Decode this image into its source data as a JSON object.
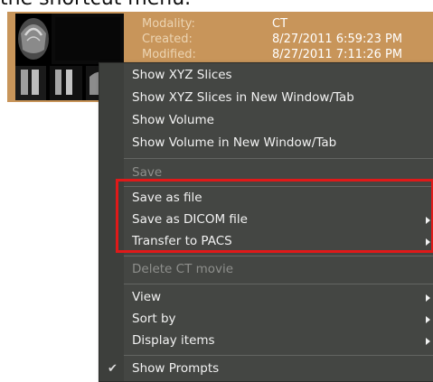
{
  "caption": "the shortcut menu.",
  "study": {
    "fields": [
      {
        "key": "Modality:",
        "value": "CT"
      },
      {
        "key": "Created:",
        "value": "8/27/2011 6:59:23 PM"
      },
      {
        "key": "Modified:",
        "value": "8/27/2011 7:11:26 PM"
      }
    ]
  },
  "menu": {
    "items": [
      {
        "label": "Show XYZ Slices"
      },
      {
        "label": "Show XYZ Slices in New Window/Tab"
      },
      {
        "label": "Show Volume"
      },
      {
        "label": "Show Volume in New Window/Tab"
      },
      {
        "label": "Save"
      },
      {
        "label": "Save as file"
      },
      {
        "label": "Save as DICOM file"
      },
      {
        "label": "Transfer to PACS"
      },
      {
        "label": "Delete CT movie"
      },
      {
        "label": "View"
      },
      {
        "label": "Sort by"
      },
      {
        "label": "Display items"
      },
      {
        "label": "Show Prompts",
        "checked": true
      }
    ]
  },
  "colors": {
    "tile_bg": "#c8955a",
    "menu_bg": "#444643",
    "highlight": "#e01919"
  }
}
